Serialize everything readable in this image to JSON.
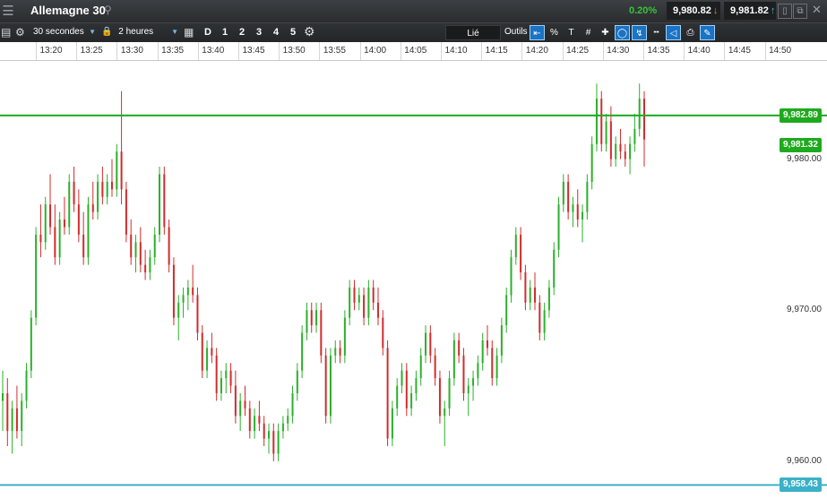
{
  "window": {
    "title": "Allemagne 30",
    "change_pct": "0.20%",
    "sell_price": "9,980.82",
    "buy_price": "9,981.82",
    "icons": {
      "menu": "hamburger-icon",
      "search": "search-icon",
      "restore": "restore-window-icon",
      "close": "close-icon"
    }
  },
  "toolbar": {
    "interval": "30 secondes",
    "range": "2 heures",
    "periods": [
      "D",
      "1",
      "2",
      "3",
      "4",
      "5"
    ],
    "linked_label": "Lié",
    "tools_label": "Outils",
    "percent_label": "%",
    "text_label": "T"
  },
  "chart_data": {
    "type": "candlestick",
    "instrument": "Allemagne 30",
    "x_ticks": [
      "13:20",
      "13:25",
      "13:30",
      "13:35",
      "13:40",
      "13:45",
      "13:50",
      "13:55",
      "14:00",
      "14:05",
      "14:10",
      "14:15",
      "14:20",
      "14:25",
      "14:30",
      "14:35",
      "14:40",
      "14:45",
      "14:50"
    ],
    "y_ticks": [
      "9,980.00",
      "9,970.00",
      "9,960.00"
    ],
    "ylim": [
      9957.5,
      9986.5
    ],
    "up_color": "#2bb02b",
    "down_color": "#d32b2b",
    "reference_lines": [
      {
        "value": 9982.89,
        "label": "9,982.89",
        "color": "#1eaa1e"
      },
      {
        "value": 9958.43,
        "label": "9,958.43",
        "color": "#3ab1c8"
      }
    ],
    "current_price": {
      "value": 9981.32,
      "label": "9,981.32",
      "color": "#1eaa1e"
    },
    "candles": [
      [
        9964.0,
        9966.0,
        9962.0,
        9964.5
      ],
      [
        9964.5,
        9965.5,
        9961.0,
        9962.0
      ],
      [
        9962.0,
        9964.0,
        9960.5,
        9963.5
      ],
      [
        9963.5,
        9965.0,
        9961.5,
        9962.0
      ],
      [
        9962.0,
        9964.5,
        9961.0,
        9964.0
      ],
      [
        9964.0,
        9966.5,
        9963.5,
        9966.0
      ],
      [
        9966.0,
        9970.0,
        9965.5,
        9969.5
      ],
      [
        9969.5,
        9975.5,
        9969.0,
        9975.0
      ],
      [
        9975.0,
        9977.0,
        9973.5,
        9974.5
      ],
      [
        9974.5,
        9977.5,
        9974.0,
        9977.0
      ],
      [
        9977.0,
        9979.0,
        9975.0,
        9975.5
      ],
      [
        9975.5,
        9977.0,
        9973.0,
        9973.5
      ],
      [
        9973.5,
        9976.5,
        9973.0,
        9976.0
      ],
      [
        9976.0,
        9977.5,
        9975.0,
        9975.5
      ],
      [
        9975.5,
        9979.0,
        9975.0,
        9978.5
      ],
      [
        9978.5,
        9979.5,
        9976.5,
        9977.0
      ],
      [
        9977.0,
        9978.0,
        9974.5,
        9975.0
      ],
      [
        9975.0,
        9976.5,
        9973.0,
        9973.5
      ],
      [
        9973.5,
        9977.5,
        9973.0,
        9977.0
      ],
      [
        9977.0,
        9978.5,
        9976.0,
        9976.5
      ],
      [
        9976.5,
        9979.0,
        9976.0,
        9978.5
      ],
      [
        9978.5,
        9979.5,
        9977.0,
        9977.5
      ],
      [
        9977.5,
        9979.0,
        9977.0,
        9978.5
      ],
      [
        9978.5,
        9980.0,
        9977.5,
        9978.0
      ],
      [
        9978.0,
        9981.0,
        9977.5,
        9980.5
      ],
      [
        9980.5,
        9984.5,
        9977.0,
        9978.0
      ],
      [
        9978.0,
        9978.5,
        9974.5,
        9975.0
      ],
      [
        9975.0,
        9976.0,
        9973.0,
        9973.5
      ],
      [
        9973.5,
        9975.0,
        9972.5,
        9974.5
      ],
      [
        9974.5,
        9975.5,
        9972.5,
        9973.0
      ],
      [
        9973.0,
        9974.0,
        9972.0,
        9972.5
      ],
      [
        9972.5,
        9974.0,
        9972.0,
        9973.5
      ],
      [
        9973.5,
        9975.5,
        9973.0,
        9975.0
      ],
      [
        9975.0,
        9979.5,
        9974.5,
        9979.0
      ],
      [
        9979.0,
        9979.5,
        9975.0,
        9975.5
      ],
      [
        9975.5,
        9976.0,
        9972.5,
        9973.0
      ],
      [
        9973.0,
        9973.5,
        9969.0,
        9969.5
      ],
      [
        9969.5,
        9971.0,
        9968.0,
        9970.5
      ],
      [
        9970.5,
        9971.5,
        9969.5,
        9971.0
      ],
      [
        9971.0,
        9972.0,
        9970.0,
        9971.5
      ],
      [
        9971.5,
        9973.0,
        9970.5,
        9971.0
      ],
      [
        9971.0,
        9971.5,
        9968.0,
        9968.5
      ],
      [
        9968.5,
        9969.0,
        9965.5,
        9966.0
      ],
      [
        9966.0,
        9968.0,
        9965.5,
        9967.5
      ],
      [
        9967.5,
        9968.5,
        9966.5,
        9967.0
      ],
      [
        9967.0,
        9967.5,
        9964.0,
        9964.5
      ],
      [
        9964.5,
        9966.0,
        9964.0,
        9965.5
      ],
      [
        9965.5,
        9966.5,
        9964.5,
        9966.0
      ],
      [
        9966.0,
        9966.5,
        9964.5,
        9965.0
      ],
      [
        9965.0,
        9966.0,
        9962.5,
        9963.0
      ],
      [
        9963.0,
        9964.5,
        9962.0,
        9964.0
      ],
      [
        9964.0,
        9965.0,
        9963.0,
        9963.5
      ],
      [
        9963.5,
        9964.0,
        9961.5,
        9962.0
      ],
      [
        9962.0,
        9963.5,
        9961.5,
        9963.0
      ],
      [
        9963.0,
        9964.0,
        9962.0,
        9962.5
      ],
      [
        9962.5,
        9963.0,
        9961.0,
        9961.5
      ],
      [
        9961.5,
        9962.5,
        9960.5,
        9962.0
      ],
      [
        9962.0,
        9962.5,
        9960.0,
        9960.5
      ],
      [
        9960.5,
        9962.5,
        9960.0,
        9962.0
      ],
      [
        9962.0,
        9963.0,
        9961.5,
        9962.5
      ],
      [
        9962.5,
        9963.5,
        9962.0,
        9963.0
      ],
      [
        9963.0,
        9965.0,
        9962.5,
        9964.5
      ],
      [
        9964.5,
        9966.5,
        9964.0,
        9966.0
      ],
      [
        9966.0,
        9969.0,
        9965.5,
        9968.5
      ],
      [
        9968.5,
        9970.5,
        9968.0,
        9970.0
      ],
      [
        9970.0,
        9970.5,
        9968.5,
        9969.0
      ],
      [
        9969.0,
        9970.5,
        9968.5,
        9970.0
      ],
      [
        9970.0,
        9970.5,
        9966.5,
        9967.0
      ],
      [
        9967.0,
        9967.5,
        9962.5,
        9963.0
      ],
      [
        9963.0,
        9967.5,
        9962.5,
        9967.0
      ],
      [
        9967.0,
        9968.0,
        9966.5,
        9967.5
      ],
      [
        9967.5,
        9968.0,
        9966.5,
        9967.0
      ],
      [
        9967.0,
        9970.0,
        9966.5,
        9969.5
      ],
      [
        9969.5,
        9972.0,
        9969.0,
        9971.5
      ],
      [
        9971.5,
        9972.0,
        9970.0,
        9970.5
      ],
      [
        9970.5,
        9971.5,
        9970.0,
        9971.0
      ],
      [
        9971.0,
        9971.5,
        9969.0,
        9969.5
      ],
      [
        9969.5,
        9972.0,
        9969.0,
        9971.5
      ],
      [
        9971.5,
        9972.0,
        9970.0,
        9970.5
      ],
      [
        9970.5,
        9971.5,
        9969.0,
        9969.5
      ],
      [
        9969.5,
        9970.0,
        9967.0,
        9967.5
      ],
      [
        9967.5,
        9968.0,
        9961.0,
        9961.5
      ],
      [
        9961.5,
        9964.0,
        9961.0,
        9963.5
      ],
      [
        9963.5,
        9965.5,
        9963.0,
        9965.0
      ],
      [
        9965.0,
        9966.5,
        9964.5,
        9966.0
      ],
      [
        9966.0,
        9966.5,
        9963.0,
        9963.5
      ],
      [
        9963.5,
        9965.0,
        9963.0,
        9964.5
      ],
      [
        9964.5,
        9966.0,
        9964.0,
        9965.5
      ],
      [
        9965.5,
        9967.5,
        9965.0,
        9967.0
      ],
      [
        9967.0,
        9969.0,
        9966.5,
        9968.5
      ],
      [
        9968.5,
        9969.0,
        9966.5,
        9967.0
      ],
      [
        9967.0,
        9967.5,
        9965.0,
        9965.5
      ],
      [
        9965.5,
        9966.0,
        9962.5,
        9963.0
      ],
      [
        9963.0,
        9964.0,
        9961.0,
        9963.5
      ],
      [
        9963.5,
        9966.0,
        9963.0,
        9965.5
      ],
      [
        9965.5,
        9968.5,
        9965.0,
        9968.0
      ],
      [
        9968.0,
        9968.5,
        9966.5,
        9967.0
      ],
      [
        9967.0,
        9967.5,
        9964.0,
        9964.5
      ],
      [
        9964.5,
        9965.5,
        9963.0,
        9965.0
      ],
      [
        9965.0,
        9966.0,
        9964.0,
        9965.5
      ],
      [
        9965.5,
        9967.0,
        9965.0,
        9966.5
      ],
      [
        9966.5,
        9968.5,
        9966.0,
        9968.0
      ],
      [
        9968.0,
        9969.0,
        9967.0,
        9967.5
      ],
      [
        9967.5,
        9968.0,
        9965.0,
        9965.5
      ],
      [
        9965.5,
        9967.5,
        9965.0,
        9967.0
      ],
      [
        9967.0,
        9969.5,
        9966.5,
        9969.0
      ],
      [
        9969.0,
        9971.5,
        9968.5,
        9971.0
      ],
      [
        9971.0,
        9974.0,
        9970.5,
        9973.5
      ],
      [
        9973.5,
        9975.5,
        9973.0,
        9975.0
      ],
      [
        9975.0,
        9975.5,
        9972.0,
        9972.5
      ],
      [
        9972.5,
        9973.0,
        9970.0,
        9970.5
      ],
      [
        9970.5,
        9972.0,
        9970.0,
        9971.5
      ],
      [
        9971.5,
        9972.5,
        9970.0,
        9970.5
      ],
      [
        9970.5,
        9971.0,
        9968.0,
        9968.5
      ],
      [
        9968.5,
        9970.5,
        9968.0,
        9970.0
      ],
      [
        9970.0,
        9972.0,
        9969.5,
        9971.5
      ],
      [
        9971.5,
        9974.5,
        9971.0,
        9974.0
      ],
      [
        9974.0,
        9977.5,
        9973.5,
        9977.0
      ],
      [
        9977.0,
        9979.0,
        9976.5,
        9978.5
      ],
      [
        9978.5,
        9979.0,
        9976.0,
        9976.5
      ],
      [
        9976.5,
        9977.5,
        9975.5,
        9977.0
      ],
      [
        9977.0,
        9978.0,
        9975.5,
        9976.0
      ],
      [
        9976.0,
        9977.0,
        9974.5,
        9976.5
      ],
      [
        9976.5,
        9979.0,
        9976.0,
        9978.5
      ],
      [
        9978.5,
        9981.5,
        9978.0,
        9981.0
      ],
      [
        9981.0,
        9985.0,
        9980.5,
        9984.0
      ],
      [
        9984.0,
        9984.5,
        9980.5,
        9981.0
      ],
      [
        9981.0,
        9983.0,
        9980.5,
        9982.5
      ],
      [
        9982.5,
        9983.5,
        9979.5,
        9980.0
      ],
      [
        9980.0,
        9981.5,
        9979.5,
        9981.0
      ],
      [
        9981.0,
        9982.0,
        9980.0,
        9980.5
      ],
      [
        9980.5,
        9981.0,
        9979.5,
        9980.0
      ],
      [
        9980.0,
        9981.5,
        9979.0,
        9981.0
      ],
      [
        9981.0,
        9983.0,
        9980.5,
        9982.0
      ],
      [
        9982.0,
        9985.0,
        9981.5,
        9984.0
      ],
      [
        9984.0,
        9984.5,
        9979.5,
        9981.3
      ]
    ]
  }
}
